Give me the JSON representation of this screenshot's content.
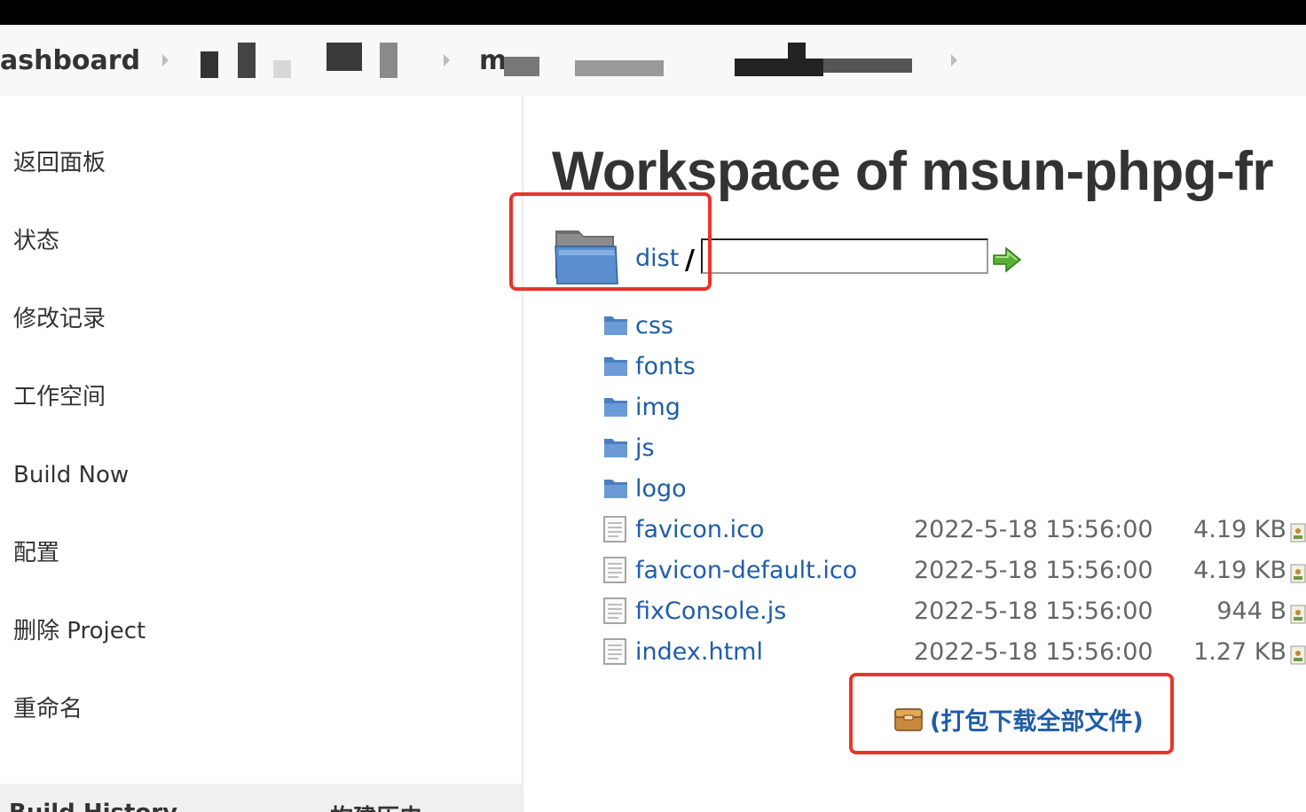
{
  "breadcrumb": {
    "items": [
      {
        "label": "ashboard"
      },
      {
        "label": ""
      },
      {
        "label": "m"
      },
      {
        "label": ""
      }
    ]
  },
  "sidebar": {
    "items": [
      {
        "label": "返回面板"
      },
      {
        "label": "状态"
      },
      {
        "label": "修改记录"
      },
      {
        "label": "工作空间"
      },
      {
        "label": "Build Now"
      },
      {
        "label": "配置"
      },
      {
        "label": "删除 Project"
      },
      {
        "label": "重命名"
      }
    ],
    "history_label": "Build History",
    "history_label_cn": "构建历史"
  },
  "main": {
    "title": "Workspace of msun-phpg-fr",
    "path_link": "dist",
    "path_separator": "/",
    "path_input_value": "",
    "entries": [
      {
        "name": "css",
        "type": "folder",
        "date": "",
        "size": ""
      },
      {
        "name": "fonts",
        "type": "folder",
        "date": "",
        "size": ""
      },
      {
        "name": "img",
        "type": "folder",
        "date": "",
        "size": ""
      },
      {
        "name": "js",
        "type": "folder",
        "date": "",
        "size": ""
      },
      {
        "name": "logo",
        "type": "folder",
        "date": "",
        "size": ""
      },
      {
        "name": "favicon.ico",
        "type": "file",
        "date": "2022-5-18 15:56:00",
        "size": "4.19 KB"
      },
      {
        "name": "favicon-default.ico",
        "type": "file",
        "date": "2022-5-18 15:56:00",
        "size": "4.19 KB"
      },
      {
        "name": "fixConsole.js",
        "type": "file",
        "date": "2022-5-18 15:56:00",
        "size": "944 B"
      },
      {
        "name": "index.html",
        "type": "file",
        "date": "2022-5-18 15:56:00",
        "size": "1.27 KB"
      }
    ],
    "download_all_label": "(打包下载全部文件)"
  },
  "colors": {
    "link": "#1f5da8",
    "annotation": "#e8352a",
    "folder": "#5b8fd0"
  },
  "icons": {
    "folder": "folder-icon",
    "file": "file-icon",
    "go": "go-arrow-icon",
    "zip": "package-icon",
    "view": "view-icon"
  }
}
